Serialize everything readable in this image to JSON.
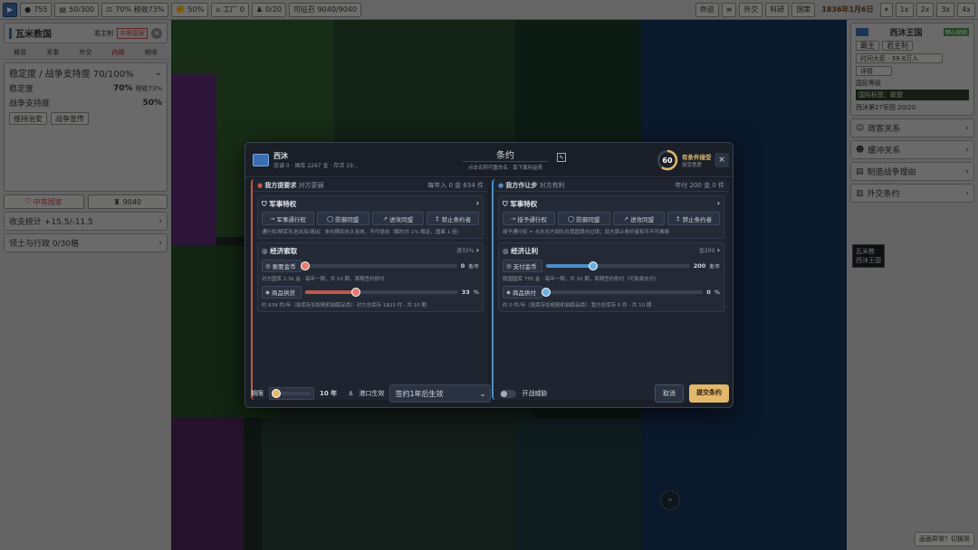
{
  "topbar": {
    "menu_label": "▶",
    "items": [
      "755",
      "50/300",
      "70% 税收73%",
      "50%",
      "工厂 0",
      "0/20",
      "可征召 9040/9040"
    ],
    "right": [
      "命运",
      "≡",
      "外交",
      "科研",
      "国策"
    ],
    "date": "1836年1月6日",
    "speeds": [
      "⏸",
      "1x",
      "2x",
      "3x",
      "4x"
    ]
  },
  "left": {
    "country": "瓦米教国",
    "ruler": "君主制",
    "rank_badge": "中等国家",
    "tabs": [
      "概览",
      "军事",
      "外交",
      "内政",
      "税收"
    ],
    "stability_title": "稳定度 / 战争支持度 70/100%",
    "stability_label": "稳定度",
    "stability_value": "70%",
    "tax_label": "税收73%",
    "war_label": "战争支持度",
    "war_value": "50%",
    "btn1": "维持治安",
    "btn2": "战争宣传",
    "country_btn": "中等国家",
    "troops": "9040",
    "budget_label": "收支统计 +15.5/-11.5",
    "territory_label": "领土与行政 0/30格"
  },
  "right": {
    "country": "西沐王国",
    "badge": "野心勃勃",
    "tags": [
      "霸主",
      "君主制"
    ],
    "population": "时间大臣 · 39.8万人",
    "detail": "详情",
    "status": "国民等级",
    "alliance": "国际标签：联盟",
    "army": "西沐第27军团 20/20",
    "items": [
      "政客关系",
      "缓冲关系",
      "制造战争理由",
      "外交条约"
    ],
    "tooltip_line1": "瓦米教",
    "tooltip_line2": "西沐王国",
    "corner_hint": "画面异常？切换简"
  },
  "modal": {
    "party_name": "西沐",
    "party_sub": "忠诚 0 · 国库 2267 金 · 存活 19...",
    "title": "条约",
    "subtitle": "点击名称可重命名 · 靠下属利益表",
    "score": "60",
    "accept_label": "有条件接受",
    "accept_sub": "接受意愿",
    "left_col": {
      "header": "我方提要求",
      "header_sub": "对方更弱",
      "header_right": "每年入 0 金 634 件",
      "military": {
        "title": "军事特权",
        "buttons": [
          "军事通行权",
          "防御同盟",
          "进攻同盟",
          "禁止条约者"
        ],
        "note": "通行权/随军队进出双/退出：条约期间永久有效，不可提前（解约方 1% 稳定，国庫 1 倍）"
      },
      "economic": {
        "title": "经济索取",
        "title_right": "进33%",
        "slider1_label": "索要金币",
        "slider1_value": "0",
        "slider1_unit": "金/年",
        "slider1_note": "对方国库 2.3k 金 · 每年一期，共 10 期，首期签约即付",
        "slider2_label": "商品供货",
        "slider2_value": "33",
        "slider2_unit": "%",
        "slider2_note": "约 634 件/年（按库存加权随机抽取品类）· 对方总库存 1923 件 · 共 10 期"
      }
    },
    "right_col": {
      "header": "我方作让步",
      "header_sub": "对方有利",
      "header_right": "年付 200 金 0 件",
      "military": {
        "title": "军事特权",
        "buttons": [
          "授予通行权",
          "防御同盟",
          "进攻同盟",
          "禁止条约者"
        ],
        "note": "授予通行权 = 允许对方部队在我国境内过境；双方禁止条约者和平不可撕毁"
      },
      "economic": {
        "title": "经济让利",
        "title_right": "金200",
        "slider1_label": "支付金币",
        "slider1_value": "200",
        "slider1_unit": "金/年",
        "slider1_note": "我国国库 755 金 · 每年一期，共 10 期，首期签约即付（可免费支付）",
        "slider2_label": "商品供付",
        "slider2_value": "0",
        "slider2_unit": "%",
        "slider2_note": "约 0 件/年（按库存加权随机抽取品类）· 我方总库存 0 件 · 共 10 期"
      }
    },
    "footer": {
      "duration_label": "期限",
      "duration_value": "10 年",
      "port_label": "港口生效",
      "select_value": "签约1年后生效",
      "toggle_label": "开战威胁",
      "cancel": "取消",
      "submit": "提交条约"
    }
  },
  "colors": {
    "accent": "#e3b86a",
    "left": "#c0584a",
    "right": "#4a8ec9"
  },
  "sliders": {
    "l1": 0.0,
    "l2": 0.33,
    "r1": 0.33,
    "r2": 0.0,
    "duration": 0.1
  }
}
